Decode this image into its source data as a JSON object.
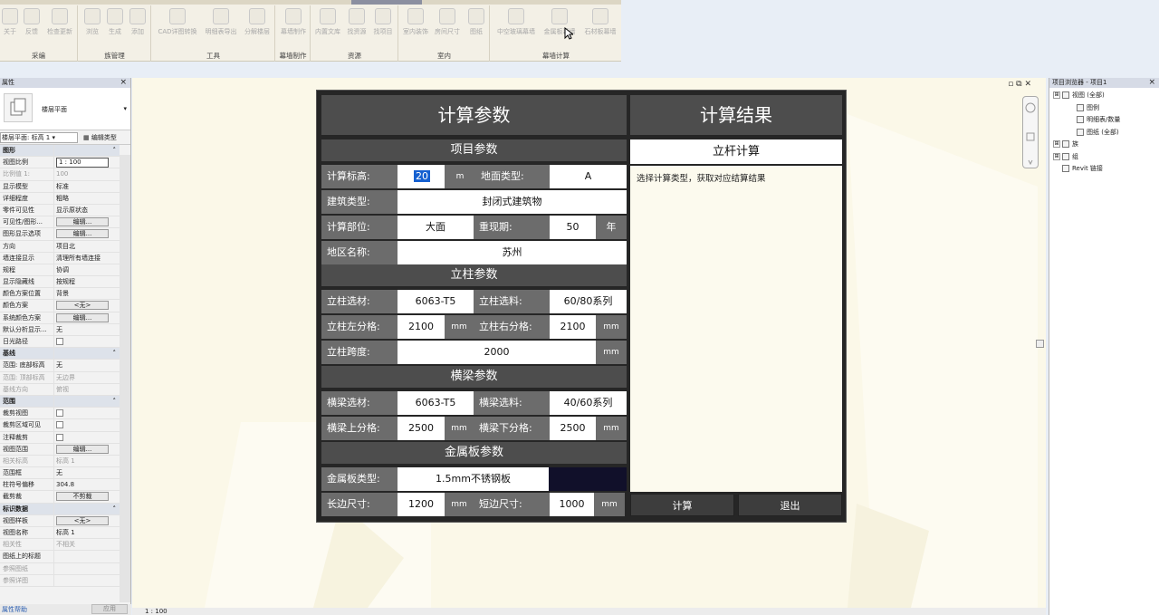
{
  "ribbon": {
    "groups": [
      {
        "label": "采编",
        "buttons": [
          "关于",
          "反馈",
          "检查更新"
        ]
      },
      {
        "label": "族管理",
        "buttons": [
          "浏览",
          "生成",
          "添加"
        ]
      },
      {
        "label": "工具",
        "buttons": [
          "CAD详图转换",
          "明细表导出",
          "分解楼层"
        ]
      },
      {
        "label": "幕墙制作",
        "buttons": [
          "幕墙制作"
        ]
      },
      {
        "label": "资源",
        "buttons": [
          "内置文库",
          "找资源",
          "找项目"
        ]
      },
      {
        "label": "室内",
        "buttons": [
          "室内装饰",
          "房间尺寸",
          "图纸"
        ]
      },
      {
        "label": "幕墙计算",
        "buttons": [
          "中空玻璃幕墙",
          "金属板幕墙",
          "石材板幕墙"
        ]
      }
    ]
  },
  "properties": {
    "title": "属性",
    "type_name": "楼层平面",
    "selector": "楼层平面: 标高 1",
    "edit_type": "编辑类型",
    "rows": [
      {
        "k": "图形",
        "v": "",
        "kind": "sec"
      },
      {
        "k": "视图比例",
        "v": "1 : 100",
        "kind": "input"
      },
      {
        "k": "比例值 1:",
        "v": "100",
        "kind": "grey"
      },
      {
        "k": "显示模型",
        "v": "标准",
        "kind": ""
      },
      {
        "k": "详细程度",
        "v": "粗略",
        "kind": ""
      },
      {
        "k": "零件可见性",
        "v": "显示原状态",
        "kind": ""
      },
      {
        "k": "可见性/图形...",
        "v": "编辑...",
        "kind": "btn"
      },
      {
        "k": "图形显示选项",
        "v": "编辑...",
        "kind": "btn"
      },
      {
        "k": "方向",
        "v": "项目北",
        "kind": ""
      },
      {
        "k": "墙连接显示",
        "v": "清理所有墙连接",
        "kind": ""
      },
      {
        "k": "规程",
        "v": "协调",
        "kind": ""
      },
      {
        "k": "显示隐藏线",
        "v": "按规程",
        "kind": ""
      },
      {
        "k": "颜色方案位置",
        "v": "背景",
        "kind": ""
      },
      {
        "k": "颜色方案",
        "v": "<无>",
        "kind": "btn"
      },
      {
        "k": "系统颜色方案",
        "v": "编辑...",
        "kind": "btn"
      },
      {
        "k": "默认分析显示...",
        "v": "无",
        "kind": ""
      },
      {
        "k": "日光路径",
        "v": "",
        "kind": "chk"
      },
      {
        "k": "基线",
        "v": "",
        "kind": "sec"
      },
      {
        "k": "范围: 底部标高",
        "v": "无",
        "kind": ""
      },
      {
        "k": "范围: 顶部标高",
        "v": "无边界",
        "kind": "grey"
      },
      {
        "k": "基线方向",
        "v": "俯视",
        "kind": "grey"
      },
      {
        "k": "范围",
        "v": "",
        "kind": "sec"
      },
      {
        "k": "裁剪视图",
        "v": "",
        "kind": "chk"
      },
      {
        "k": "裁剪区域可见",
        "v": "",
        "kind": "chk"
      },
      {
        "k": "注释裁剪",
        "v": "",
        "kind": "chk"
      },
      {
        "k": "视图范围",
        "v": "编辑...",
        "kind": "btn"
      },
      {
        "k": "相关标高",
        "v": "标高 1",
        "kind": "grey"
      },
      {
        "k": "范围框",
        "v": "无",
        "kind": ""
      },
      {
        "k": "柱符号偏移",
        "v": "304.8",
        "kind": ""
      },
      {
        "k": "截剪裁",
        "v": "不剪裁",
        "kind": "btn"
      },
      {
        "k": "标识数据",
        "v": "",
        "kind": "sec"
      },
      {
        "k": "视图样板",
        "v": "<无>",
        "kind": "btn"
      },
      {
        "k": "视图名称",
        "v": "标高 1",
        "kind": ""
      },
      {
        "k": "相关性",
        "v": "不相关",
        "kind": "grey"
      },
      {
        "k": "图纸上的标题",
        "v": "",
        "kind": ""
      },
      {
        "k": "参照图纸",
        "v": "",
        "kind": "grey"
      },
      {
        "k": "参照详图",
        "v": "",
        "kind": "grey"
      }
    ],
    "help_link": "属性帮助",
    "apply": "应用"
  },
  "browser": {
    "title": "项目浏览器 - 项目1",
    "items": [
      {
        "label": "视图 (全部)",
        "expand": "⊞",
        "indent": 0
      },
      {
        "label": "图例",
        "expand": "",
        "indent": 1
      },
      {
        "label": "明细表/数量",
        "expand": "",
        "indent": 1
      },
      {
        "label": "图纸 (全部)",
        "expand": "",
        "indent": 1
      },
      {
        "label": "族",
        "expand": "⊞",
        "indent": 0
      },
      {
        "label": "组",
        "expand": "⊞",
        "indent": 0
      },
      {
        "label": "Revit 链接",
        "expand": "",
        "indent": 0
      }
    ]
  },
  "statusbar": {
    "scale": "1 : 100"
  },
  "dialog": {
    "params_title": "计算参数",
    "results_title": "计算结果",
    "project": {
      "title": "项目参数",
      "calc_elev_label": "计算标高:",
      "calc_elev_value": "20",
      "calc_elev_unit": "m",
      "terrain_label": "地面类型:",
      "terrain_value": "A",
      "building_label": "建筑类型:",
      "building_value": "封闭式建筑物",
      "part_label": "计算部位:",
      "part_value": "大面",
      "period_label": "重现期:",
      "period_value": "50",
      "period_unit": "年",
      "region_label": "地区名称:",
      "region_value": "苏州"
    },
    "column": {
      "title": "立柱参数",
      "mat_label": "立柱选材:",
      "mat_value": "6063-T5",
      "series_label": "立柱选料:",
      "series_value": "60/80系列",
      "left_label": "立柱左分格:",
      "left_value": "2100",
      "left_unit": "mm",
      "right_label": "立柱右分格:",
      "right_value": "2100",
      "right_unit": "mm",
      "span_label": "立柱跨度:",
      "span_value": "2000",
      "span_unit": "mm"
    },
    "beam": {
      "title": "横梁参数",
      "mat_label": "横梁选材:",
      "mat_value": "6063-T5",
      "series_label": "横梁选料:",
      "series_value": "40/60系列",
      "up_label": "横梁上分格:",
      "up_value": "2500",
      "up_unit": "mm",
      "down_label": "横梁下分格:",
      "down_value": "2500",
      "down_unit": "mm"
    },
    "metal": {
      "title": "金属板参数",
      "type_label": "金属板类型:",
      "type_value": "1.5mm不锈钢板",
      "long_label": "长边尺寸:",
      "long_value": "1200",
      "long_unit": "mm",
      "short_label": "短边尺寸:",
      "short_value": "1000",
      "short_unit": "mm"
    },
    "result_type": "立杆计算",
    "result_text": "选择计算类型，获取对应结算结果",
    "calc_button": "计算",
    "exit_button": "退出"
  }
}
